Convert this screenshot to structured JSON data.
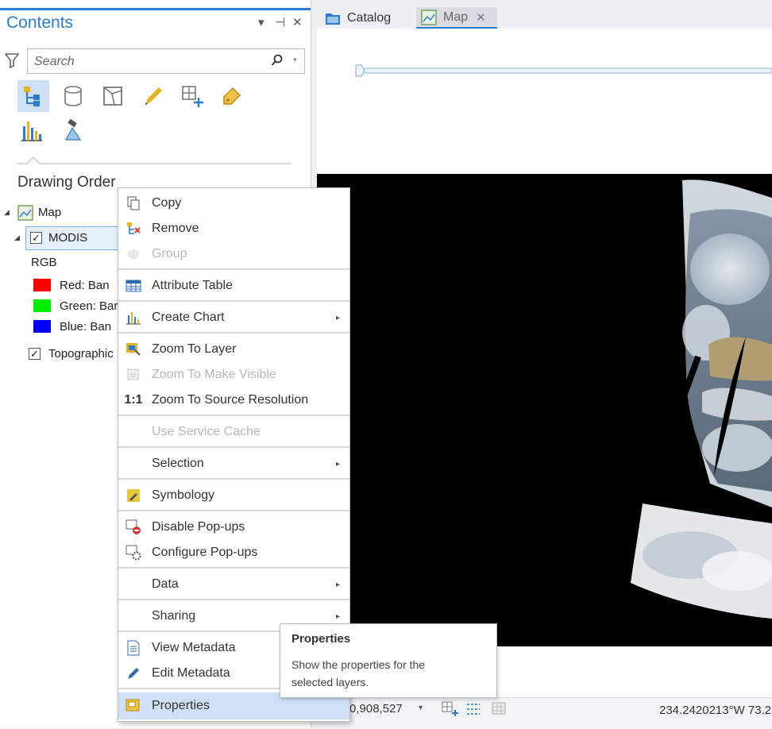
{
  "contents_pane": {
    "title": "Contents",
    "controls": {
      "menu": "▾",
      "pin": "⊣",
      "close": "✕"
    },
    "search_placeholder": "Search",
    "drawing_order_label": "Drawing Order",
    "tree": {
      "map": "Map",
      "modis": "MODIS",
      "rgb": "RGB",
      "bands": [
        {
          "label": "Red:  Ban",
          "color": "#ff0000"
        },
        {
          "label": "Green: Bar",
          "color": "#00ee00"
        },
        {
          "label": "Blue:  Ban",
          "color": "#0000ff"
        }
      ],
      "topographic": "Topographic"
    }
  },
  "tabs": {
    "catalog": "Catalog",
    "map": "Map"
  },
  "context_menu": {
    "copy": "Copy",
    "remove": "Remove",
    "group": "Group",
    "attribute_table": "Attribute Table",
    "create_chart": "Create Chart",
    "zoom_to_layer": "Zoom To Layer",
    "zoom_to_make_visible": "Zoom To Make Visible",
    "zoom_to_source_resolution": "Zoom To Source Resolution",
    "zoom_ratio_icon": "1:1",
    "use_service_cache": "Use Service Cache",
    "selection": "Selection",
    "symbology": "Symbology",
    "disable_popups": "Disable Pop-ups",
    "configure_popups": "Configure Pop-ups",
    "data": "Data",
    "sharing": "Sharing",
    "view_metadata": "View Metadata",
    "edit_metadata": "Edit Metadata",
    "properties": "Properties"
  },
  "tooltip": {
    "title": "Properties",
    "line1": "Show the properties for the",
    "line2": "selected layers."
  },
  "status_bar": {
    "scale": "0,908,527",
    "coordinates": "234.2420213°W 73.2"
  }
}
